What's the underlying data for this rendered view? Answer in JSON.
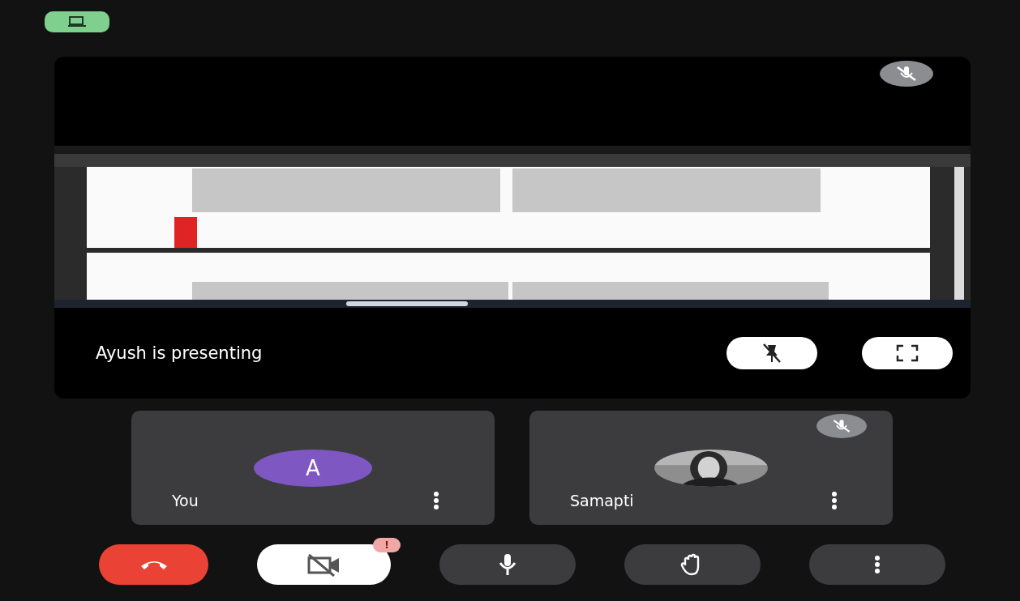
{
  "presentation": {
    "muted": true,
    "caption": "Ayush is presenting",
    "pinned": false
  },
  "participants": [
    {
      "name": "You",
      "avatar": {
        "kind": "initial",
        "letter": "A",
        "color": "#7e57c2"
      },
      "muted": false
    },
    {
      "name": "Samapti",
      "muted": true
    }
  ],
  "controls": [
    {
      "kind": "end-call"
    },
    {
      "kind": "camera",
      "on": false,
      "alert": "!"
    },
    {
      "kind": "mic",
      "on": true
    },
    {
      "kind": "hand"
    },
    {
      "kind": "more"
    }
  ]
}
